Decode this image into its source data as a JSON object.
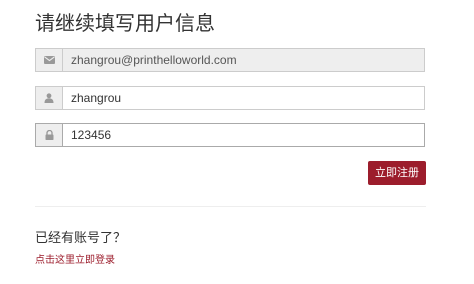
{
  "page": {
    "title": "请继续填写用户信息"
  },
  "form": {
    "email": {
      "value": "zhangrou@printhelloworld.com",
      "icon": "envelope-icon"
    },
    "username": {
      "value": "zhangrou",
      "icon": "user-icon"
    },
    "password": {
      "value": "123456",
      "icon": "lock-icon"
    },
    "submit_label": "立即注册"
  },
  "footer": {
    "prompt": "已经有账号了？",
    "login_link": "点击这里立即登录"
  },
  "colors": {
    "accent": "#9c1d2c",
    "addon_bg": "#eeeeee",
    "border": "#cccccc",
    "icon": "#999999"
  }
}
